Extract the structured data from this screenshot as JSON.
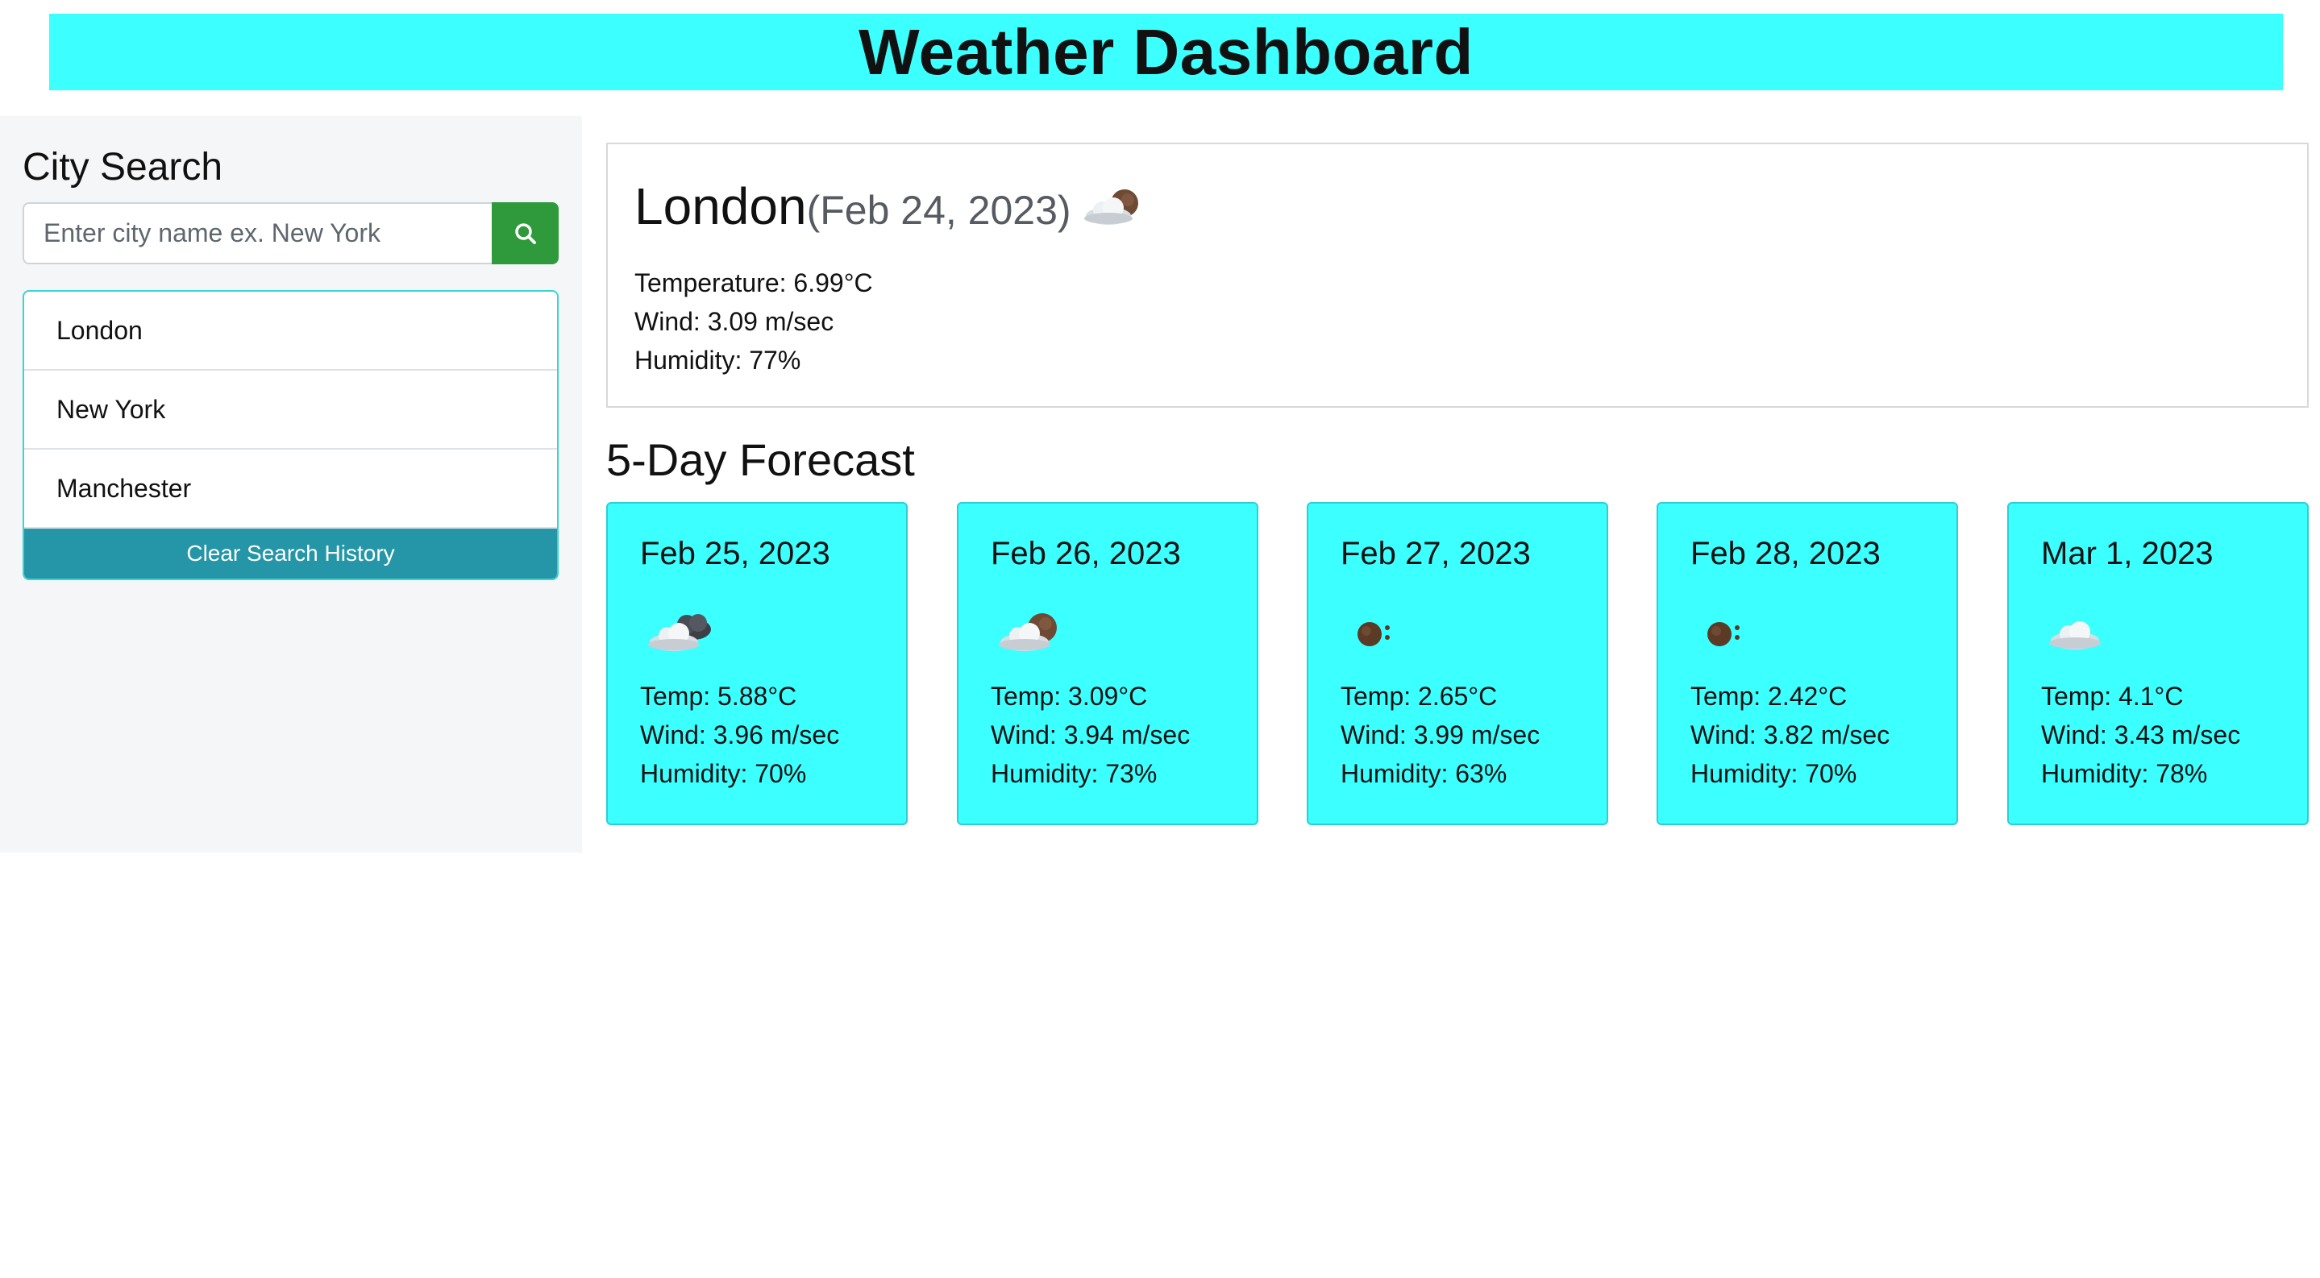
{
  "header": {
    "title": "Weather Dashboard"
  },
  "sidebar": {
    "title": "City Search",
    "search": {
      "placeholder": "Enter city name ex. New York",
      "value": ""
    },
    "history": [
      {
        "label": "London"
      },
      {
        "label": "New York"
      },
      {
        "label": "Manchester"
      }
    ],
    "clear_label": "Clear Search History"
  },
  "current": {
    "city": "London",
    "date": "(Feb 24, 2023)",
    "icon": "partly-cloudy-icon",
    "temperature": "Temperature: 6.99°C",
    "wind": "Wind: 3.09 m/sec",
    "humidity": "Humidity: 77%"
  },
  "forecast": {
    "title": "5-Day Forecast",
    "days": [
      {
        "date": "Feb 25, 2023",
        "icon": "cloudy-dark-icon",
        "temp": "Temp: 5.88°C",
        "wind": "Wind: 3.96 m/sec",
        "humidity": "Humidity: 70%"
      },
      {
        "date": "Feb 26, 2023",
        "icon": "partly-cloudy-icon",
        "temp": "Temp: 3.09°C",
        "wind": "Wind: 3.94 m/sec",
        "humidity": "Humidity: 73%"
      },
      {
        "date": "Feb 27, 2023",
        "icon": "overcast-dot-icon",
        "temp": "Temp: 2.65°C",
        "wind": "Wind: 3.99 m/sec",
        "humidity": "Humidity: 63%"
      },
      {
        "date": "Feb 28, 2023",
        "icon": "overcast-dot-icon",
        "temp": "Temp: 2.42°C",
        "wind": "Wind: 3.82 m/sec",
        "humidity": "Humidity: 70%"
      },
      {
        "date": "Mar 1, 2023",
        "icon": "cloud-icon",
        "temp": "Temp: 4.1°C",
        "wind": "Wind: 3.43 m/sec",
        "humidity": "Humidity: 78%"
      }
    ]
  },
  "colors": {
    "header_bg": "#3cffff",
    "card_bg": "#3cffff",
    "search_button": "#2e9a3b",
    "clear_button": "#2596a8",
    "sidebar_bg": "#f5f6f8"
  }
}
